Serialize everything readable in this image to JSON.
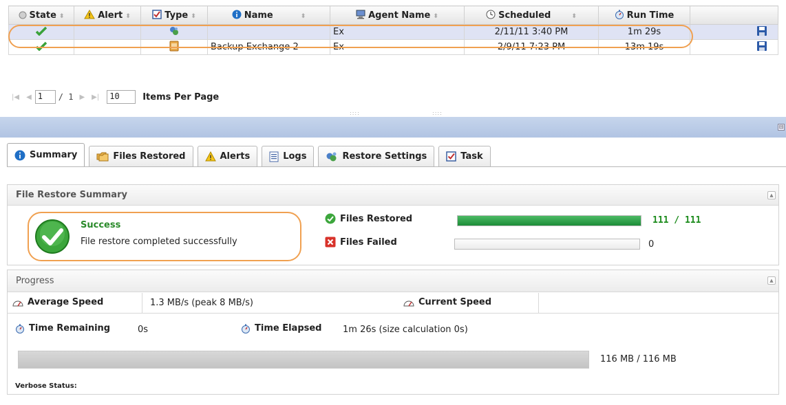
{
  "grid": {
    "columns": [
      {
        "label": "State",
        "icon": "circle-icon"
      },
      {
        "label": "Alert",
        "icon": "warning-icon"
      },
      {
        "label": "Type",
        "icon": "task-icon"
      },
      {
        "label": "Name",
        "icon": "info-icon"
      },
      {
        "label": "Agent Name",
        "icon": "computer-icon"
      },
      {
        "label": "Scheduled",
        "icon": "clock-icon"
      },
      {
        "label": "Run Time",
        "icon": "stopwatch-icon"
      }
    ],
    "rows": [
      {
        "state": "success",
        "type": "restore",
        "name": "",
        "agent": "Ex",
        "scheduled": "2/11/11 3:40 PM",
        "run_time": "1m 29s",
        "selected": true
      },
      {
        "state": "success",
        "type": "backup",
        "name": "Backup Exchange 2",
        "agent": "Ex",
        "scheduled": "2/9/11 7:23 PM",
        "run_time": "13m 19s",
        "selected": false
      }
    ]
  },
  "pager": {
    "page": "1",
    "page_total": "/ 1",
    "items_per_page": "10",
    "items_per_page_label": "Items Per Page"
  },
  "tabs": [
    {
      "label": "Summary",
      "icon": "info-icon",
      "active": true
    },
    {
      "label": "Files Restored",
      "icon": "folders-icon",
      "active": false
    },
    {
      "label": "Alerts",
      "icon": "warning-icon",
      "active": false
    },
    {
      "label": "Logs",
      "icon": "log-icon",
      "active": false
    },
    {
      "label": "Restore Settings",
      "icon": "restore-icon",
      "active": false
    },
    {
      "label": "Task",
      "icon": "task-icon",
      "active": false
    }
  ],
  "summary": {
    "title": "File Restore Summary",
    "status": "Success",
    "message": "File restore completed successfully",
    "files_restored_label": "Files Restored",
    "files_restored_count": "111 / 111",
    "files_restored_fraction": 1.0,
    "files_failed_label": "Files Failed",
    "files_failed_count": "0",
    "files_failed_fraction": 0.0
  },
  "progress": {
    "title": "Progress",
    "avg_speed_label": "Average Speed",
    "avg_speed_value": "1.3 MB/s (peak 8 MB/s)",
    "current_speed_label": "Current Speed",
    "current_speed_value": "",
    "time_remaining_label": "Time Remaining",
    "time_remaining_value": "0s",
    "time_elapsed_label": "Time Elapsed",
    "time_elapsed_value": "1m 26s (size calculation 0s)",
    "size_text": "116 MB / 116 MB",
    "size_fraction": 1.0,
    "verbose_label": "Verbose Status:"
  },
  "colors": {
    "success": "#2a8a2a",
    "highlight": "#f0a050",
    "selected_row": "#dfe3f4",
    "band": "#b8c9e6"
  }
}
